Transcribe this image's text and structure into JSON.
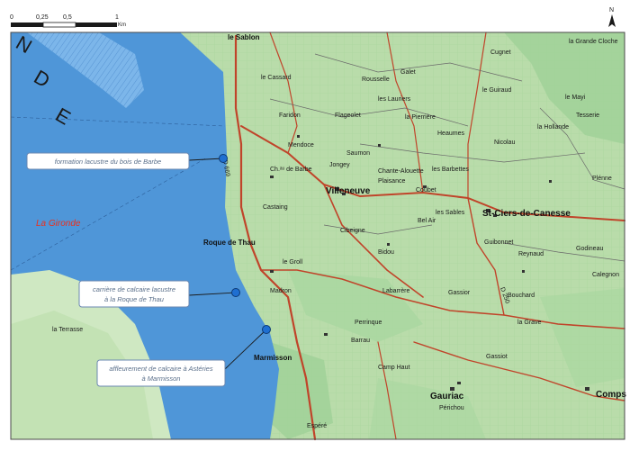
{
  "scale_bar": {
    "ticks": [
      "0",
      "0,25",
      "0,5",
      "1"
    ],
    "unit": "Km"
  },
  "north": "N",
  "river": {
    "name": "La Gironde",
    "big_letters": [
      "N",
      "D",
      "E"
    ]
  },
  "callouts": [
    {
      "lines": [
        "formation lacustre du bois de Barbe"
      ]
    },
    {
      "lines": [
        "carrière de calcaire lacustre",
        "à la Roque de Thau"
      ]
    },
    {
      "lines": [
        "affleurement de calcaire à Astéries",
        "à Marmisson"
      ]
    }
  ],
  "places": {
    "villeneuve": "Villeneuve",
    "st_ciers": "St-Ciers-de-Canesse",
    "gauriac": "Gauriac",
    "roque_de_thau": "Roque de Thau",
    "marmisson": "Marmisson",
    "comps": "Comps",
    "le_sablon": "le Sablon",
    "mendoce": "Mendoce",
    "faridon": "Faridon",
    "barbe": "Ch.ᵃᵘ de Barbe",
    "castaing": "Castaing",
    "jongey": "Jongey",
    "coubet": "Coubet",
    "bidou": "Bidou",
    "cibeigne": "Cibeigne",
    "heaumes": "Heaumes",
    "nicolau": "Nicolau",
    "la_hollande": "la Hollande",
    "le_guiraud": "le Guiraud",
    "les_lauriers": "les Lauriers",
    "flageolet": "Flageolet",
    "galet": "Galet",
    "cugnet": "Cugnet",
    "le_mayi": "le Mayi",
    "tesserie": "Tesserie",
    "la_grande_cloche": "la Grande Cloche",
    "godineau": "Godineau",
    "reynaud": "Reynaud",
    "calegnon": "Calegnon",
    "perrinque": "Perrinque",
    "barrau": "Barrau",
    "camp_haut": "Camp Haut",
    "perichou": "Périchou",
    "la_terrasse": "la Terrasse",
    "le_cassard": "le Cassard",
    "chante_alouette": "Chante-Alouette",
    "plaisance": "Plaisance",
    "saumon": "Saumon",
    "bel_air": "Bel Air",
    "les_sables": "les Sables",
    "gassior": "Gassior",
    "labarrere": "Labarrère",
    "bouchard": "Bouchard",
    "la_pierriere": "la Pierrière",
    "les_barbettes": "les Barbettes",
    "guibonnet": "Guibonnet",
    "rousselle": "Rousselle",
    "madron": "Madron",
    "le_groll": "le Groll",
    "espere": "Espéré",
    "gassiot": "Gassiot",
    "plenne": "Plénne",
    "la_grave": "la Grave"
  },
  "roads": {
    "d669": "D 669",
    "d250": "D 250"
  },
  "colors": {
    "river": "#4f96d8",
    "river_light": "#7cb6ea",
    "land": "#b9dcaa",
    "land_light": "#cfe8c2",
    "wood_green": "#8fc98a",
    "road": "#c0442a",
    "callout_border": "#6b88b2",
    "marker": "#1f6fd1",
    "river_label": "#e8311f"
  }
}
